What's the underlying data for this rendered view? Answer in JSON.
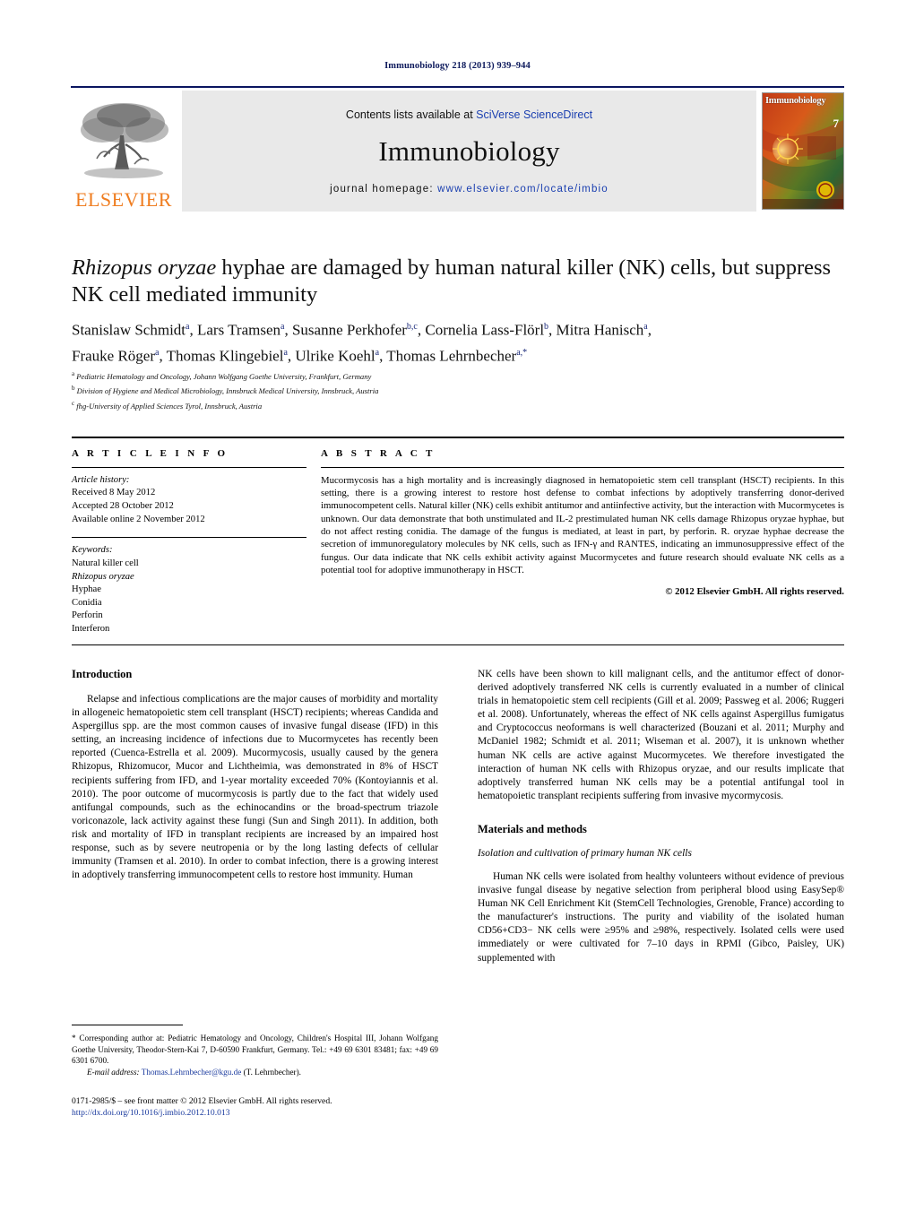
{
  "running_head": "Immunobiology 218 (2013) 939–944",
  "masthead": {
    "contents_prefix": "Contents lists available at ",
    "contents_link": "SciVerse ScienceDirect",
    "journal_name": "Immunobiology",
    "homepage_prefix": "journal homepage: ",
    "homepage_url": "www.elsevier.com/locate/imbio",
    "publisher_logo_text": "ELSEVIER",
    "cover_title": "Immunobiology",
    "cover_issue": "7"
  },
  "article": {
    "title_italic": "Rhizopus oryzae",
    "title_rest": " hyphae are damaged by human natural killer (NK) cells, but suppress NK cell mediated immunity",
    "authors": "Stanislaw Schmidt a, Lars Tramsen a, Susanne Perkhofer b,c, Cornelia Lass-Flörl b, Mitra Hanisch a, Frauke Röger a, Thomas Klingebiel a, Ulrike Koehl a, Thomas Lehrnbecher a,*",
    "affiliations": [
      {
        "mark": "a",
        "text": "Pediatric Hematology and Oncology, Johann Wolfgang Goethe University, Frankfurt, Germany"
      },
      {
        "mark": "b",
        "text": "Division of Hygiene and Medical Microbiology, Innsbruck Medical University, Innsbruck, Austria"
      },
      {
        "mark": "c",
        "text": "fhg-University of Applied Sciences Tyrol, Innsbruck, Austria"
      }
    ]
  },
  "article_info": {
    "section_label": "A R T I C L E   I N F O",
    "history_label": "Article history:",
    "history": [
      "Received 8 May 2012",
      "Accepted 28 October 2012",
      "Available online 2 November 2012"
    ],
    "keywords_label": "Keywords:",
    "keywords": [
      "Natural killer cell",
      "Rhizopus oryzae",
      "Hyphae",
      "Conidia",
      "Perforin",
      "Interferon"
    ],
    "keyword_italic_index": 1
  },
  "abstract": {
    "section_label": "A B S T R A C T",
    "text": "Mucormycosis has a high mortality and is increasingly diagnosed in hematopoietic stem cell transplant (HSCT) recipients. In this setting, there is a growing interest to restore host defense to combat infections by adoptively transferring donor-derived immunocompetent cells. Natural killer (NK) cells exhibit antitumor and antiinfective activity, but the interaction with Mucormycetes is unknown. Our data demonstrate that both unstimulated and IL-2 prestimulated human NK cells damage Rhizopus oryzae hyphae, but do not affect resting conidia. The damage of the fungus is mediated, at least in part, by perforin. R. oryzae hyphae decrease the secretion of immunoregulatory molecules by NK cells, such as IFN-γ and RANTES, indicating an immunosuppressive effect of the fungus. Our data indicate that NK cells exhibit activity against Mucormycetes and future research should evaluate NK cells as a potential tool for adoptive immunotherapy in HSCT.",
    "copyright": "© 2012 Elsevier GmbH. All rights reserved."
  },
  "body": {
    "left": {
      "intro_heading": "Introduction",
      "intro_para": "Relapse and infectious complications are the major causes of morbidity and mortality in allogeneic hematopoietic stem cell transplant (HSCT) recipients; whereas Candida and Aspergillus spp. are the most common causes of invasive fungal disease (IFD) in this setting, an increasing incidence of infections due to Mucormycetes has recently been reported (Cuenca-Estrella et al. 2009). Mucormycosis, usually caused by the genera Rhizopus, Rhizomucor, Mucor and Lichtheimia, was demonstrated in 8% of HSCT recipients suffering from IFD, and 1-year mortality exceeded 70% (Kontoyiannis et al. 2010). The poor outcome of mucormycosis is partly due to the fact that widely used antifungal compounds, such as the echinocandins or the broad-spectrum triazole voriconazole, lack activity against these fungi (Sun and Singh 2011). In addition, both risk and mortality of IFD in transplant recipients are increased by an impaired host response, such as by severe neutropenia or by the long lasting defects of cellular immunity (Tramsen et al. 2010). In order to combat infection, there is a growing interest in adoptively transferring immunocompetent cells to restore host immunity. Human"
    },
    "right": {
      "cont_para": "NK cells have been shown to kill malignant cells, and the antitumor effect of donor-derived adoptively transferred NK cells is currently evaluated in a number of clinical trials in hematopoietic stem cell recipients (Gill et al. 2009; Passweg et al. 2006; Ruggeri et al. 2008). Unfortunately, whereas the effect of NK cells against Aspergillus fumigatus and Cryptococcus neoformans is well characterized (Bouzani et al. 2011; Murphy and McDaniel 1982; Schmidt et al. 2011; Wiseman et al. 2007), it is unknown whether human NK cells are active against Mucormycetes. We therefore investigated the interaction of human NK cells with Rhizopus oryzae, and our results implicate that adoptively transferred human NK cells may be a potential antifungal tool in hematopoietic transplant recipients suffering from invasive mycormycosis.",
      "methods_heading": "Materials and methods",
      "methods_subheading": "Isolation and cultivation of primary human NK cells",
      "methods_para": "Human NK cells were isolated from healthy volunteers without evidence of previous invasive fungal disease by negative selection from peripheral blood using EasySep® Human NK Cell Enrichment Kit (StemCell Technologies, Grenoble, France) according to the manufacturer's instructions. The purity and viability of the isolated human CD56+CD3− NK cells were ≥95% and ≥98%, respectively. Isolated cells were used immediately or were cultivated for 7–10 days in RPMI (Gibco, Paisley, UK) supplemented with"
    }
  },
  "footnote": {
    "corresponding": "* Corresponding author at: Pediatric Hematology and Oncology, Children's Hospital III, Johann Wolfgang Goethe University, Theodor-Stern-Kai 7, D-60590 Frankfurt, Germany. Tel.: +49 69 6301 83481; fax: +49 69 6301 6700.",
    "email_label": "E-mail address:",
    "email": "Thomas.Lehrnbecher@kgu.de",
    "email_suffix": " (T. Lehrnbecher).",
    "imprint": "0171-2985/$ – see front matter © 2012 Elsevier GmbH. All rights reserved.",
    "doi": "http://dx.doi.org/10.1016/j.imbio.2012.10.013"
  },
  "colors": {
    "rule_navy": "#0a1560",
    "link_blue": "#1a3a9e",
    "elsevier_orange": "#ef7d20",
    "band_gray": "#e9e9e9"
  }
}
